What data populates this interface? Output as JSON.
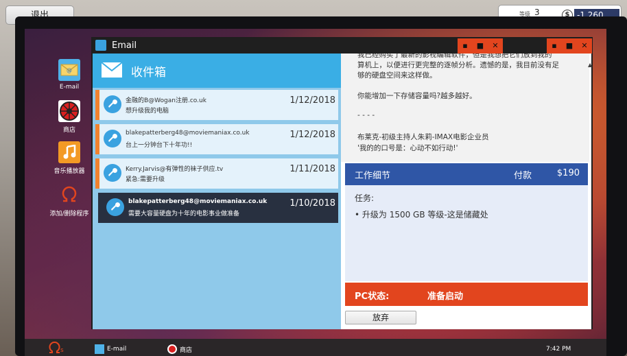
{
  "top_bar": {
    "exit_label": "退出"
  },
  "stats": {
    "level_label": "等级",
    "level_value": "3",
    "level_progress": 0.55,
    "money_symbol": "$",
    "money_value": "-1,260"
  },
  "desktop": {
    "icons": [
      {
        "label": "E-mail"
      },
      {
        "label": "商店"
      },
      {
        "label": "音乐播放器"
      },
      {
        "label": "添加/删除程序"
      }
    ]
  },
  "window": {
    "title": "Email",
    "inbox_title": "收件箱",
    "mails": [
      {
        "from": "金融的B@Wogan注册.co.uk",
        "subject": "想升级我的电脑",
        "date": "1/12/2018"
      },
      {
        "from": "blakepatterberg48@moviemaniax.co.uk",
        "subject": "台上一分钟台下十年功!!",
        "date": "1/12/2018"
      },
      {
        "from": "Kerry.Jarvis@有弹性的袜子供应.tv",
        "subject": "紧急:需要升级",
        "date": "1/11/2018"
      },
      {
        "from": "blakepatterberg48@moviemaniax.co.uk",
        "subject": "需要大容量硬盘为十年的电影事业做准备",
        "date": "1/10/2018"
      }
    ],
    "message": {
      "line1": "我已经购买了最新的影视编辑软件，但是我想把它们放到我的",
      "line2": "算机上，以便进行更完整的逐帧分析。遗憾的是，我目前没有足",
      "line3": "够的硬盘空间来这样做。",
      "line4": "你能增加一下存储容量吗?越多越好。",
      "line5": "- - - -",
      "line6": "布莱克-初级主持人朱莉-IMAX电影企业员",
      "line7": "'我的的口号是：心动不如行动!'"
    },
    "job": {
      "header_label": "工作细节",
      "payment_label": "付款",
      "payment_value": "$190",
      "task_label": "任务:",
      "task_item": "• 升级为 1500 GB 等级-这是储藏处"
    },
    "status": {
      "label": "PC状态:",
      "value": "准备启动"
    },
    "abandon_label": "放弃"
  },
  "taskbar": {
    "items": [
      {
        "label": "E-mail"
      },
      {
        "label": "商店"
      }
    ],
    "clock": "7:42 PM"
  }
}
